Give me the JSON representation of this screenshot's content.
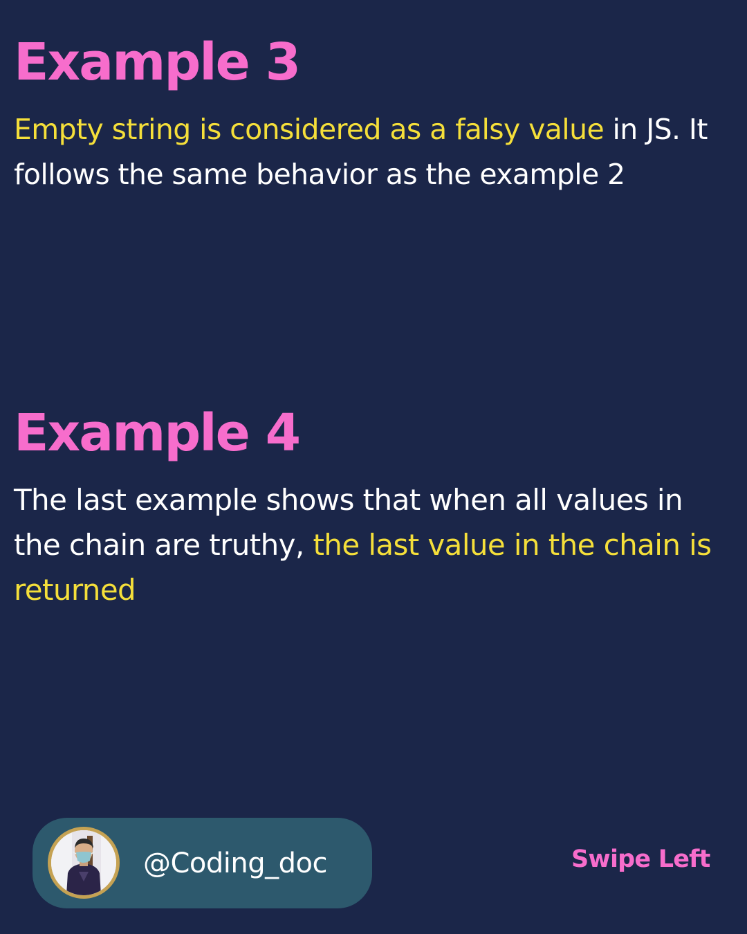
{
  "sections": [
    {
      "heading": "Example 3",
      "body": [
        {
          "text": "Empty string is considered as a falsy value",
          "highlight": true
        },
        {
          "text": " in JS. It follows the same behavior as the example 2",
          "highlight": false
        }
      ]
    },
    {
      "heading": "Example 4",
      "body": [
        {
          "text": "The last example shows that when all values in the chain are truthy, ",
          "highlight": false
        },
        {
          "text": "the last value in the chain is returned",
          "highlight": true
        }
      ]
    }
  ],
  "footer": {
    "handle": "@Coding_doc",
    "swipe_label": "Swipe Left"
  },
  "colors": {
    "background": "#1b2649",
    "heading": "#f76dcc",
    "highlight": "#f5df3a",
    "body_text": "#ffffff",
    "profile_pill": "#2d596d",
    "avatar_ring": "#c5a253"
  }
}
